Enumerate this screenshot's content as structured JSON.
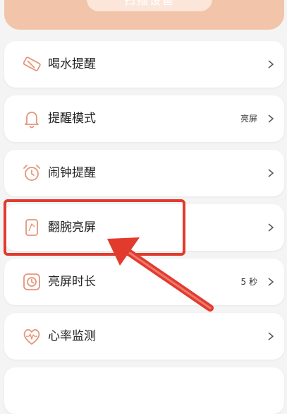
{
  "header": {
    "scan_button_label": "扫描设备"
  },
  "settings": {
    "items": [
      {
        "label": "喝水提醒",
        "value": "",
        "icon": "water-cup-icon"
      },
      {
        "label": "提醒模式",
        "value": "亮屏",
        "icon": "bell-icon"
      },
      {
        "label": "闹钟提醒",
        "value": "",
        "icon": "alarm-clock-icon"
      },
      {
        "label": "翻腕亮屏",
        "value": "",
        "icon": "wrist-raise-icon"
      },
      {
        "label": "亮屏时长",
        "value": "5 秒",
        "icon": "clock-icon"
      },
      {
        "label": "心率监测",
        "value": "",
        "icon": "heart-rate-icon"
      }
    ]
  },
  "annotation": {
    "highlighted_item": "翻腕亮屏",
    "color": "#e23b2e"
  },
  "colors": {
    "accent": "#e4967a",
    "banner": "#f2c4aa"
  }
}
